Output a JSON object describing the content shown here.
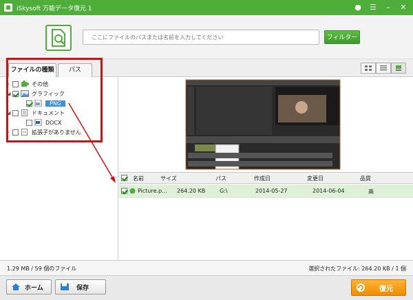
{
  "window": {
    "title": "iSkysoft 万能データ復元 1"
  },
  "search": {
    "placeholder": "ここにファイルのパスまたは名前を入力してください",
    "filter_label": "フィルター"
  },
  "tabs": [
    {
      "label": "ファイルの種類"
    },
    {
      "label": "パス"
    }
  ],
  "tree": {
    "items": [
      {
        "label": "その他"
      },
      {
        "label": "グラフィック"
      },
      {
        "label": "PNG"
      },
      {
        "label": "ドキュメント"
      },
      {
        "label": "DOCX"
      },
      {
        "label": "拡張子がありません"
      }
    ]
  },
  "grid": {
    "columns": [
      "名前",
      "サイズ",
      "パス",
      "作成日",
      "変更日",
      "品質"
    ],
    "rows": [
      {
        "name": "Picture.p...",
        "size": "264.20 KB",
        "path": "G:\\",
        "created": "2014-05-27",
        "modified": "2014-06-04",
        "quality": "高"
      }
    ]
  },
  "status": {
    "left": "1.29 MB / 59 個のファイル",
    "right": "選択されたファイル: 264.20 KB / 1 個"
  },
  "buttons": {
    "home": "ホーム",
    "save": "保存",
    "restore": "復元"
  },
  "colors": {
    "brand": "#4fae3a",
    "accent": "#f08b00",
    "annotation": "#d01010"
  }
}
